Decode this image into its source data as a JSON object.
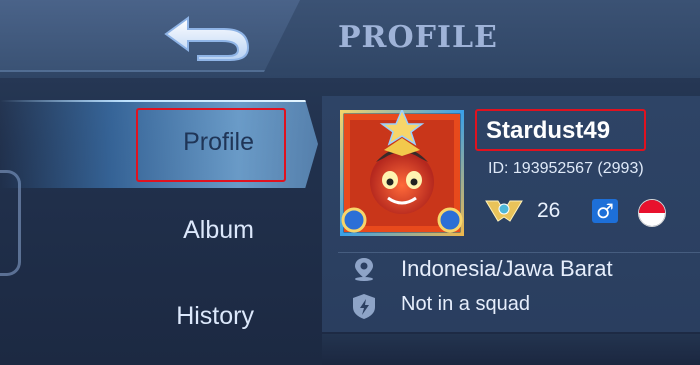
{
  "header": {
    "title": "PROFILE",
    "back_icon": "back-arrow-icon"
  },
  "sidebar": {
    "items": [
      {
        "label": "Profile",
        "active": true
      },
      {
        "label": "Album",
        "active": false
      },
      {
        "label": "History",
        "active": false
      }
    ]
  },
  "profile": {
    "username": "Stardust49",
    "id_text": "ID:  193952567 (2993)",
    "level": "26",
    "gender_icon": "male-icon",
    "flag_icon": "indonesia-flag-icon",
    "location": "Indonesia/Jawa Barat",
    "squad_status": "Not in a squad"
  },
  "colors": {
    "highlight_box": "#e0121f",
    "accent": "#6fb4ee",
    "gender_badge": "#1d6fd8"
  }
}
